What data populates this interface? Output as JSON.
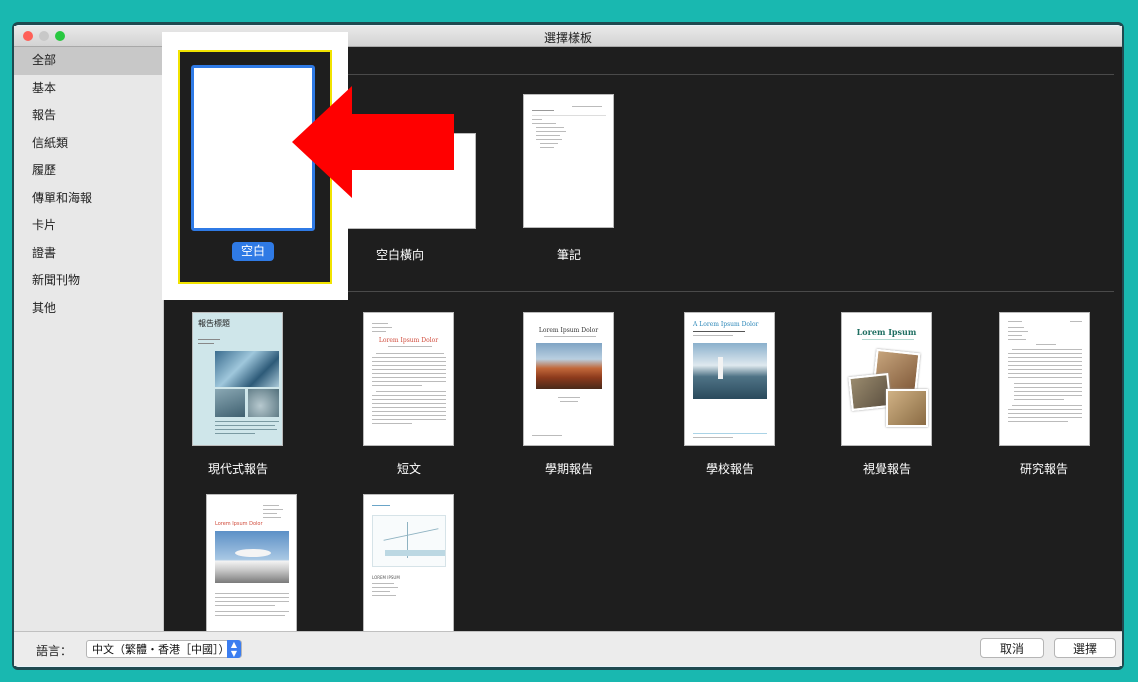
{
  "window": {
    "title": "選擇樣板"
  },
  "sidebar": {
    "items": [
      {
        "label": "全部"
      },
      {
        "label": "基本"
      },
      {
        "label": "報告"
      },
      {
        "label": "信紙類"
      },
      {
        "label": "履歷"
      },
      {
        "label": "傳單和海報"
      },
      {
        "label": "卡片"
      },
      {
        "label": "證書"
      },
      {
        "label": "新聞刊物"
      },
      {
        "label": "其他"
      }
    ],
    "selected_index": 0
  },
  "templates": {
    "basic": [
      {
        "label": "空白"
      },
      {
        "label": "空白橫向"
      },
      {
        "label": "筆記"
      }
    ],
    "reports": [
      {
        "label": "現代式報告",
        "thumb_title": "報告標題"
      },
      {
        "label": "短文",
        "thumb_title": "Lorem Ipsum Dolor"
      },
      {
        "label": "學期報告",
        "thumb_title": "Lorem Ipsum Dolor"
      },
      {
        "label": "學校報告",
        "thumb_title": "A Lorem Ipsum Dolor"
      },
      {
        "label": "視覺報告",
        "thumb_title": "Lorem Ipsum"
      },
      {
        "label": "研究報告"
      }
    ],
    "more": [
      {
        "thumb_title": "Lorem Ipsum Dolor"
      },
      {
        "thumb_title": "LOREM IPSUM"
      }
    ]
  },
  "bottombar": {
    "language_label": "語言：",
    "language_value": "中文（繁體・香港［中國］）",
    "cancel_label": "取消",
    "choose_label": "選擇"
  },
  "annotation": {
    "arrow_color": "#ff0000",
    "highlight_color": "#f1e300"
  }
}
